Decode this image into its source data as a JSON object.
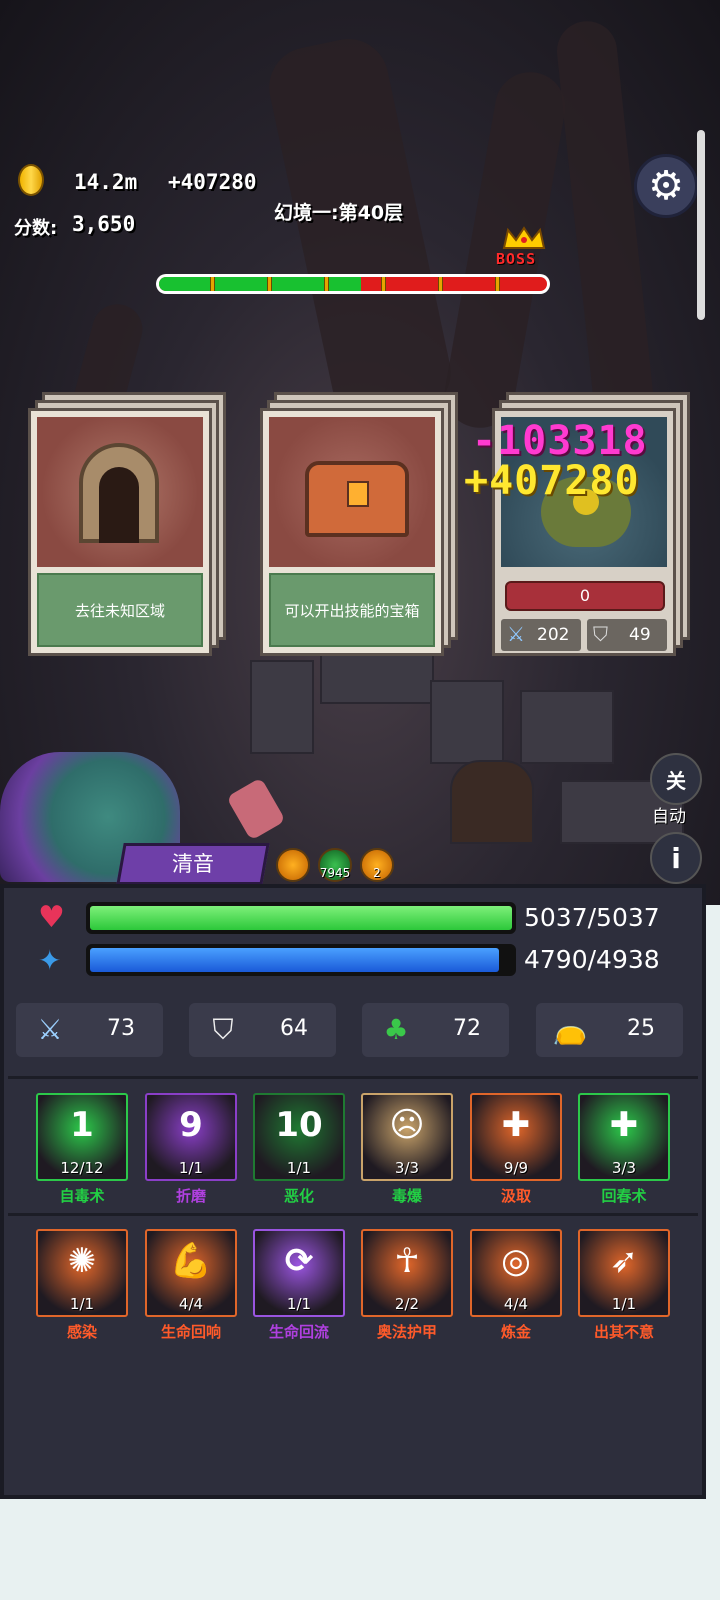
{
  "hud": {
    "gold": "14.2m",
    "gold_gain": "+407280",
    "score_label": "分数:",
    "score": "3,650",
    "floor": "幻境一:第40层",
    "boss_tag": "BOSS",
    "progress": 0.52
  },
  "cards": [
    {
      "label": "去往未知区域",
      "art": "dungeon-door"
    },
    {
      "label": "可以开出技能的宝箱",
      "art": "treasure-chest"
    },
    {
      "art": "boss-monster",
      "hp": "0",
      "atk": "202",
      "def": "49"
    }
  ],
  "damage": {
    "hit": "-103318",
    "gain": "+407280"
  },
  "controls": {
    "auto_button": "关",
    "auto_label": "自动",
    "info_button": "i"
  },
  "hero": {
    "name": "清音",
    "buffs": [
      {
        "icon": "body-aura-icon",
        "count": ""
      },
      {
        "icon": "green-skull-icon",
        "count": "7945"
      },
      {
        "icon": "fist-icon",
        "count": "2"
      }
    ]
  },
  "vitals": {
    "hp": "5037/5037",
    "hp_ratio": 1.0,
    "mp": "4790/4938",
    "mp_ratio": 0.97
  },
  "stats": [
    {
      "icon": "sword-icon",
      "value": "73"
    },
    {
      "icon": "shield-icon",
      "value": "64"
    },
    {
      "icon": "clover-icon",
      "value": "72"
    },
    {
      "icon": "money-bag-icon",
      "value": "25"
    }
  ],
  "skills_row1": [
    {
      "name": "自毒术",
      "count": "12/12",
      "glyph": "1",
      "color": "#2cc84a",
      "name_color": "#22d044"
    },
    {
      "name": "折磨",
      "count": "1/1",
      "glyph": "9",
      "color": "#8a3fc8",
      "name_color": "#b040e0"
    },
    {
      "name": "恶化",
      "count": "1/1",
      "glyph": "10",
      "color": "#1f7a32",
      "name_color": "#22d044"
    },
    {
      "name": "毒爆",
      "count": "3/3",
      "glyph": "☹",
      "color": "#c9a36a",
      "name_color": "#22d044"
    },
    {
      "name": "汲取",
      "count": "9/9",
      "glyph": "✚",
      "color": "#e0662a",
      "name_color": "#ff5a2a"
    },
    {
      "name": "回春术",
      "count": "3/3",
      "glyph": "✚",
      "color": "#2cc84a",
      "name_color": "#22d044"
    }
  ],
  "skills_row2": [
    {
      "name": "感染",
      "count": "1/1",
      "glyph": "✺",
      "color": "#e0662a",
      "name_color": "#ff5a2a"
    },
    {
      "name": "生命回响",
      "count": "4/4",
      "glyph": "💪",
      "color": "#e0662a",
      "name_color": "#ff5a2a"
    },
    {
      "name": "生命回流",
      "count": "1/1",
      "glyph": "⟳",
      "color": "#9a55e0",
      "name_color": "#b040e0"
    },
    {
      "name": "奥法护甲",
      "count": "2/2",
      "glyph": "☥",
      "color": "#e0662a",
      "name_color": "#ff5a2a"
    },
    {
      "name": "炼金",
      "count": "4/4",
      "glyph": "◎",
      "color": "#e0662a",
      "name_color": "#ff5a2a"
    },
    {
      "name": "出其不意",
      "count": "1/1",
      "glyph": "➶",
      "color": "#e0662a",
      "name_color": "#ff5a2a"
    }
  ]
}
